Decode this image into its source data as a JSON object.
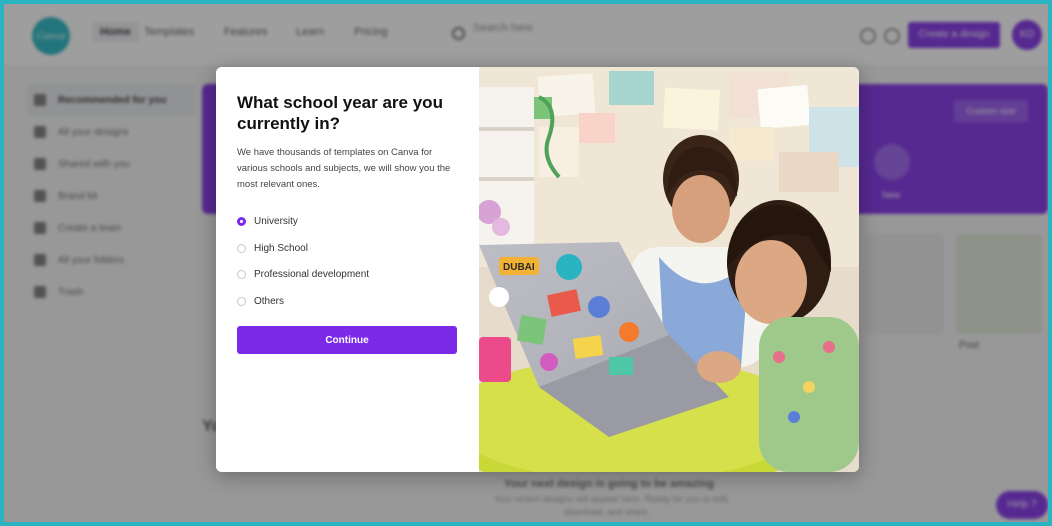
{
  "background_app": {
    "logo_text": "Canva",
    "nav": [
      "Home",
      "Templates",
      "Features",
      "Learn",
      "Pricing"
    ],
    "search_placeholder": "Search here",
    "create_design_label": "Create a design",
    "avatar_initials": "KD",
    "sidebar": [
      "Recommended for you",
      "All your designs",
      "Shared with you",
      "Brand kit",
      "Create a team",
      "All your folders",
      "Trash"
    ],
    "banner_button": "Custom size",
    "new_label": "New",
    "thumb_label": "Post",
    "section_heading_fragment": "Yo",
    "empty_title": "Your next design is going to be amazing",
    "empty_line1": "Your recent designs will appear here. Ready for you to edit,",
    "empty_line2": "download, and share.",
    "help_label": "Help ?"
  },
  "modal": {
    "title": "What school year are you currently in?",
    "description": "We have thousands of templates on Canva for various schools and subjects, we will show you the most relevant ones.",
    "options": [
      {
        "label": "University",
        "selected": true
      },
      {
        "label": "High School",
        "selected": false
      },
      {
        "label": "Professional development",
        "selected": false
      },
      {
        "label": "Others",
        "selected": false
      }
    ],
    "continue_label": "Continue",
    "photo_sticker_text": "DUBAI"
  },
  "colors": {
    "accent": "#7d2ae8",
    "frame": "#2ab3c0",
    "logo": "#1fb5c1"
  }
}
